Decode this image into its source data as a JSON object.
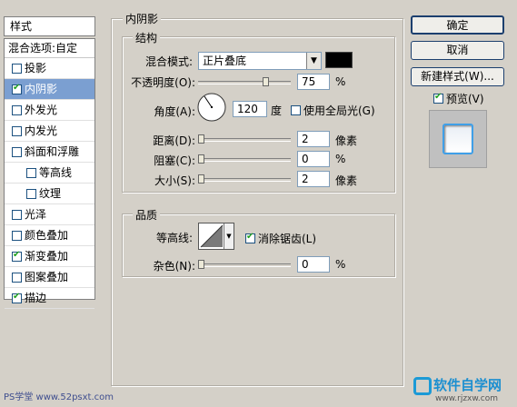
{
  "left_panel": {
    "header": "样式",
    "blend_options": "混合选项:自定",
    "items": [
      {
        "label": "投影",
        "checked": false,
        "indent": false
      },
      {
        "label": "内阴影",
        "checked": true,
        "indent": false,
        "selected": true
      },
      {
        "label": "外发光",
        "checked": false,
        "indent": false
      },
      {
        "label": "内发光",
        "checked": false,
        "indent": false
      },
      {
        "label": "斜面和浮雕",
        "checked": false,
        "indent": false
      },
      {
        "label": "等高线",
        "checked": false,
        "indent": true
      },
      {
        "label": "纹理",
        "checked": false,
        "indent": true
      },
      {
        "label": "光泽",
        "checked": false,
        "indent": false
      },
      {
        "label": "颜色叠加",
        "checked": false,
        "indent": false
      },
      {
        "label": "渐变叠加",
        "checked": true,
        "indent": false
      },
      {
        "label": "图案叠加",
        "checked": false,
        "indent": false
      },
      {
        "label": "描边",
        "checked": true,
        "indent": false
      }
    ]
  },
  "inner_shadow": {
    "title": "内阴影",
    "structure": {
      "title": "结构",
      "blend_mode_label": "混合模式:",
      "blend_mode_value": "正片叠底",
      "shadow_color": "#000000",
      "opacity_label": "不透明度(O):",
      "opacity_value": "75",
      "opacity_unit": "%",
      "angle_label": "角度(A):",
      "angle_value": "120",
      "angle_unit": "度",
      "global_light_label": "使用全局光(G)",
      "global_light_checked": false,
      "distance_label": "距离(D):",
      "distance_value": "2",
      "distance_unit": "像素",
      "choke_label": "阻塞(C):",
      "choke_value": "0",
      "choke_unit": "%",
      "size_label": "大小(S):",
      "size_value": "2",
      "size_unit": "像素"
    },
    "quality": {
      "title": "品质",
      "contour_label": "等高线:",
      "anti_alias_label": "消除锯齿(L)",
      "anti_alias_checked": true,
      "noise_label": "杂色(N):",
      "noise_value": "0",
      "noise_unit": "%"
    }
  },
  "right_panel": {
    "ok_label": "确定",
    "cancel_label": "取消",
    "new_style_label": "新建样式(W)...",
    "preview_label": "预览(V)",
    "preview_checked": true
  },
  "watermarks": {
    "left": "PS学堂 www.52psxt.com",
    "right_brand": "软件自学网",
    "right_url": "www.rjzxw.com"
  }
}
